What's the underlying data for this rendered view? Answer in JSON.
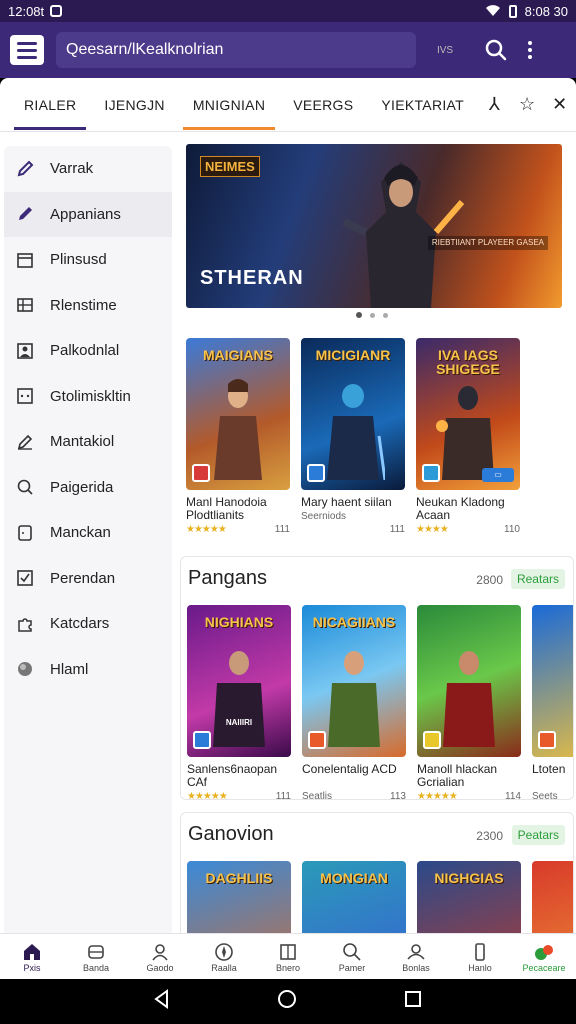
{
  "status_bar": {
    "time": "12:08t",
    "right_text": "8:08 30"
  },
  "app_bar": {
    "search_text": "Qeesarn/lKealknolrian",
    "small_label": "IVS"
  },
  "tabs": [
    {
      "label": "RIALER"
    },
    {
      "label": "IJENGJN"
    },
    {
      "label": "MNIGNIAN"
    },
    {
      "label": "VEERGS"
    },
    {
      "label": "YIEKTARIAT"
    }
  ],
  "sidebar": {
    "items": [
      {
        "label": "Varrak",
        "icon": "pencil-icon"
      },
      {
        "label": "Appanians",
        "icon": "pencil-icon"
      },
      {
        "label": "Plinsusd",
        "icon": "calendar-icon"
      },
      {
        "label": "Rlenstime",
        "icon": "grid-icon"
      },
      {
        "label": "Palkodnlal",
        "icon": "person-card-icon"
      },
      {
        "label": "Gtolimiskltin",
        "icon": "square-dots-icon"
      },
      {
        "label": "Mantakiol",
        "icon": "edit-icon"
      },
      {
        "label": "Paigerida",
        "icon": "search-icon"
      },
      {
        "label": "Manckan",
        "icon": "square-icon"
      },
      {
        "label": "Perendan",
        "icon": "checkbox-icon"
      },
      {
        "label": "Katcdars",
        "icon": "puzzle-icon"
      },
      {
        "label": "Hlaml",
        "icon": "globe-icon"
      }
    ]
  },
  "hero": {
    "badge": "NEIMES",
    "title": "STHERAN",
    "tag": "RIEBTIIANT PLAYEER GASEA"
  },
  "featured_row": {
    "cards": [
      {
        "cover_title": "MAIGIANS",
        "name": "Manl Hanodoia Plodtlianits",
        "stars": "★★★★★",
        "count": "111"
      },
      {
        "cover_title": "MICIGIANR",
        "name": "Mary haent siilan",
        "sub": "Seerniods",
        "stars": "",
        "count": "111"
      },
      {
        "cover_title": "IVA IAGS SHIGEGE",
        "name": "Neukan Kladong Acaan",
        "stars": "★★★★",
        "count": "110"
      }
    ]
  },
  "section1": {
    "title": "Pangans",
    "count": "2800",
    "pill": "Reatars",
    "cards": [
      {
        "cover_title": "NIGHIANS",
        "caption": "NAIIIRI",
        "name": "Sanlens6naopan CAf",
        "stars": "★★★★★",
        "count": "111"
      },
      {
        "cover_title": "NICAGIIANS",
        "name": "Conelentalig ACD",
        "sub": "Seatlis",
        "stars": "",
        "count": "113"
      },
      {
        "cover_title": "",
        "name": "Manoll hlackan Gcrialian",
        "stars": "★★★★★",
        "count": "114"
      },
      {
        "cover_title": "V",
        "name": "Ltoten",
        "sub": "Seets",
        "stars": "",
        "count": ""
      }
    ]
  },
  "section2": {
    "title": "Ganovion",
    "count": "2300",
    "pill": "Peatars",
    "cards": [
      {
        "cover_title": "DAGHLIIS"
      },
      {
        "cover_title": "MONGIAN"
      },
      {
        "cover_title": "NIGHGIAS"
      },
      {
        "cover_title": "IL"
      }
    ]
  },
  "bottom_nav": [
    {
      "label": "Pxis",
      "icon": "home-icon"
    },
    {
      "label": "Banda",
      "icon": "gamepad-icon"
    },
    {
      "label": "Gaodo",
      "icon": "person-icon"
    },
    {
      "label": "Raalla",
      "icon": "compass-icon"
    },
    {
      "label": "Bnero",
      "icon": "book-icon"
    },
    {
      "label": "Pamer",
      "icon": "search-icon"
    },
    {
      "label": "Bonlas",
      "icon": "people-icon"
    },
    {
      "label": "Hanlo",
      "icon": "phone-icon"
    },
    {
      "label": "Pecaceare",
      "icon": "rocket-icon"
    }
  ],
  "colors": {
    "appbar": "#3c2a78",
    "statusbar": "#2b1a52",
    "accent_orange": "#f08a2c",
    "accent_green": "#2a9d3a",
    "star": "#e8b323"
  }
}
